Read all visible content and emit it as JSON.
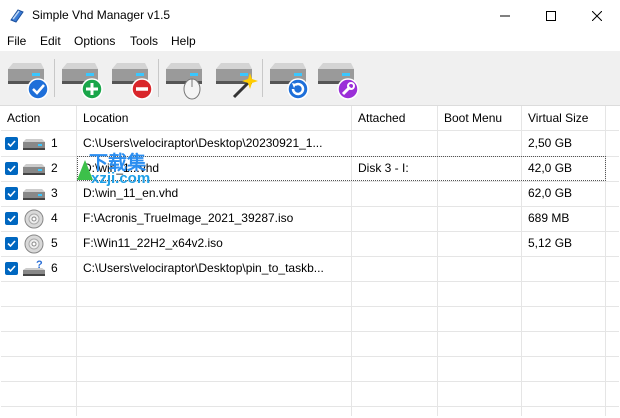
{
  "window": {
    "title": "Simple Vhd Manager v1.5"
  },
  "menu": [
    "File",
    "Edit",
    "Options",
    "Tools",
    "Help"
  ],
  "toolbar": {
    "buttons": [
      {
        "name": "check-disk-button",
        "icon": "disk-check-icon"
      },
      {
        "name": "add-disk-button",
        "icon": "disk-add-icon"
      },
      {
        "name": "remove-disk-button",
        "icon": "disk-remove-icon"
      },
      {
        "name": "mount-disk-button",
        "icon": "disk-mount-icon"
      },
      {
        "name": "create-disk-button",
        "icon": "disk-new-icon"
      },
      {
        "name": "refresh-button",
        "icon": "disk-refresh-icon"
      },
      {
        "name": "tools-button",
        "icon": "disk-tools-icon"
      }
    ]
  },
  "columns": [
    "Action",
    "Location",
    "Attached",
    "Boot Menu",
    "Virtual Size"
  ],
  "rows": [
    {
      "num": "1",
      "icon": "disk",
      "location": "C:\\Users\\velociraptor\\Desktop\\20230921_1...",
      "attached": "",
      "boot": "",
      "size": "2,50 GB"
    },
    {
      "num": "2",
      "icon": "disk",
      "location": "D:\\win_1...vhd",
      "attached": "Disk 3  -  I:",
      "boot": "",
      "size": "42,0 GB"
    },
    {
      "num": "3",
      "icon": "disk",
      "location": "D:\\win_11_en.vhd",
      "attached": "",
      "boot": "",
      "size": "62,0 GB"
    },
    {
      "num": "4",
      "icon": "cd",
      "location": "F:\\Acronis_TrueImage_2021_39287.iso",
      "attached": "",
      "boot": "",
      "size": "689 MB"
    },
    {
      "num": "5",
      "icon": "cd",
      "location": "F:\\Win11_22H2_x64v2.iso",
      "attached": "",
      "boot": "",
      "size": "5,12 GB"
    },
    {
      "num": "6",
      "icon": "disk-unknown",
      "location": "C:\\Users\\velociraptor\\Desktop\\pin_to_taskb...",
      "attached": "",
      "boot": "",
      "size": ""
    }
  ],
  "watermark": {
    "line1": "下载集",
    "line2": "xzji.com"
  },
  "colors": {
    "accent": "#0067c0",
    "toolbar_bg": "#f0f0f0",
    "grid": "#e5e5e5"
  }
}
